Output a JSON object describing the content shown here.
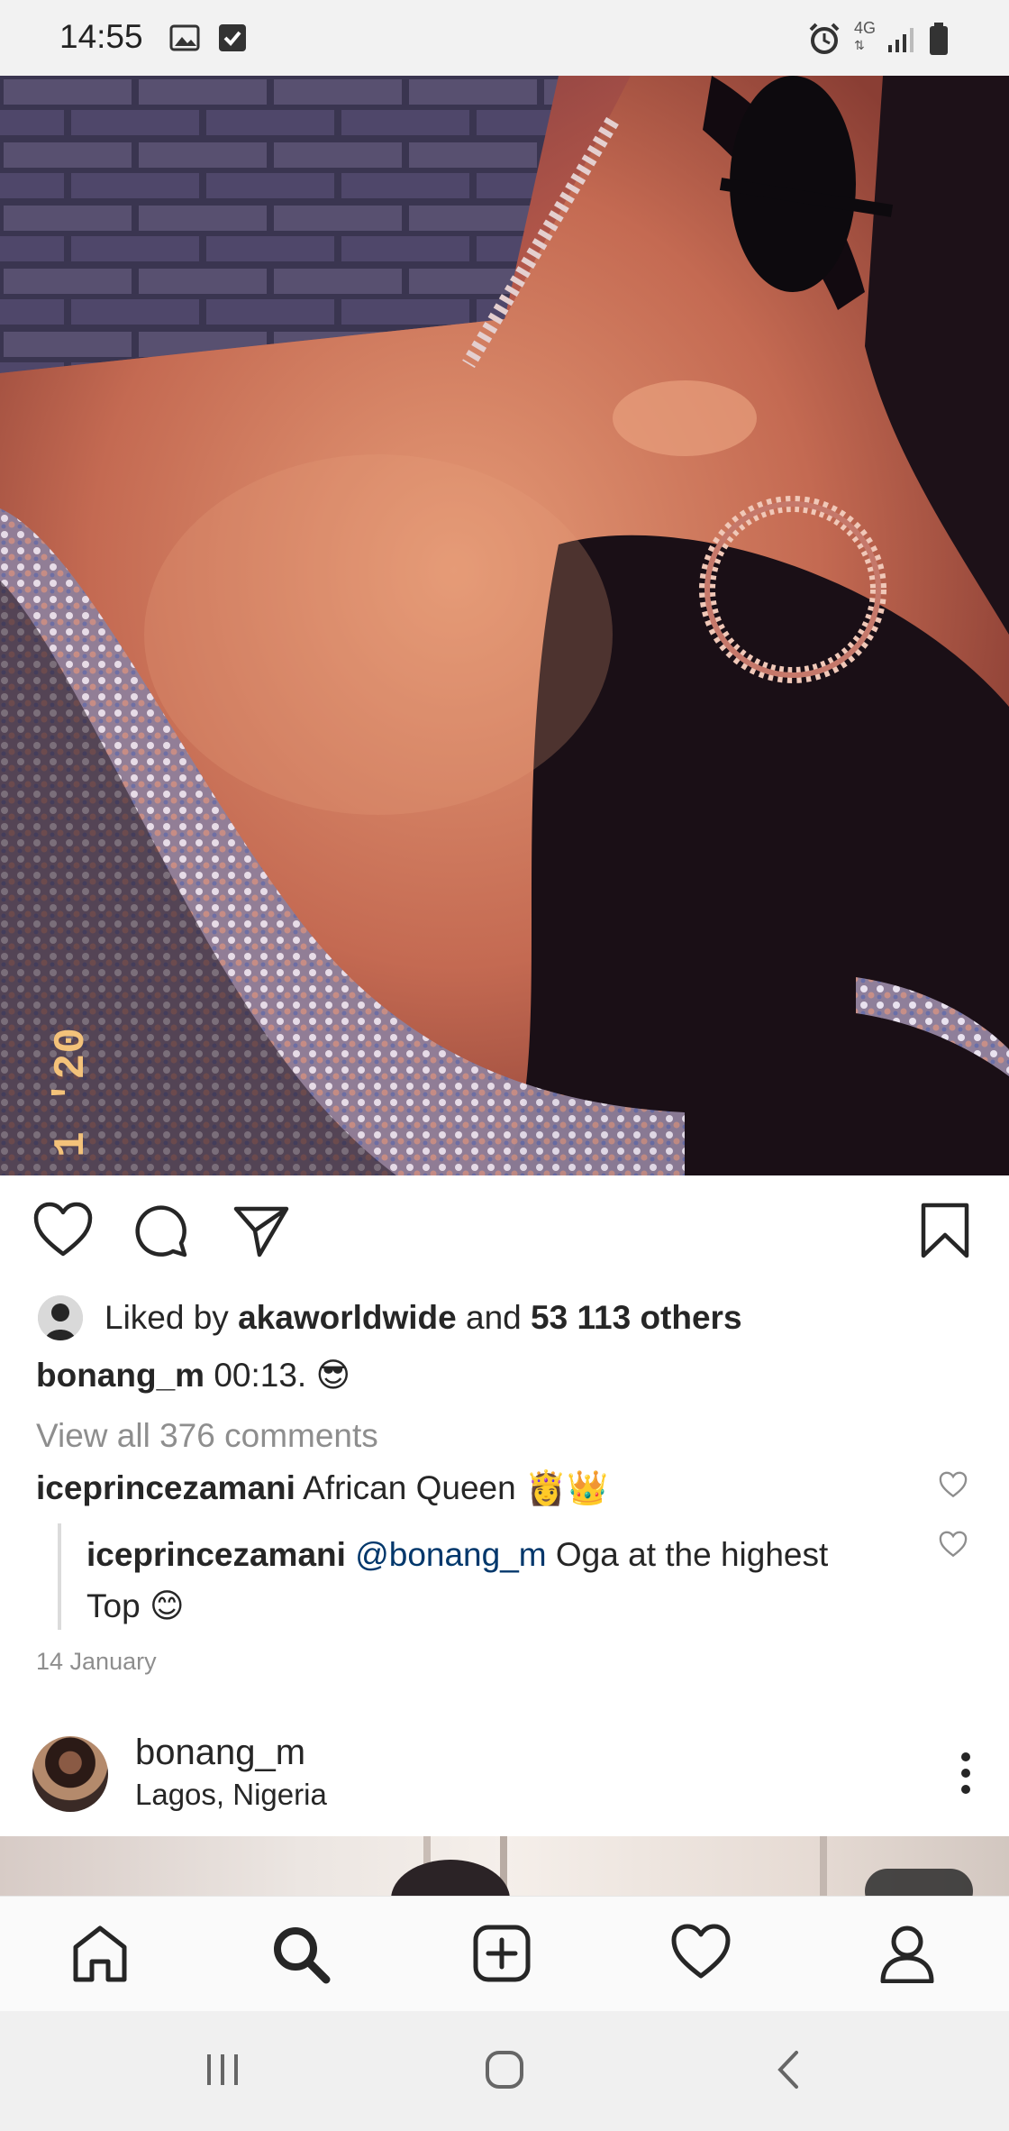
{
  "status_bar": {
    "time": "14:55",
    "network": "4G",
    "left_icons": [
      "gallery-icon",
      "check-box-icon"
    ],
    "right_icons": [
      "alarm-icon",
      "4g-data-icon",
      "signal-icon",
      "battery-icon"
    ]
  },
  "post": {
    "photo_stamp": "1 '20",
    "actions": [
      "heart-icon",
      "comment-icon",
      "share-icon",
      "bookmark-icon"
    ],
    "likes": {
      "prefix": "Liked by",
      "user": "akaworldwide",
      "joiner": "and",
      "others": "53 113 others"
    },
    "caption": {
      "username": "bonang_m",
      "text": "00:13.",
      "emoji": "😎"
    },
    "view_comments": "View all 376 comments",
    "comments": [
      {
        "username": "iceprincezamani",
        "text": "African Queen",
        "emojis": "👸👑"
      },
      {
        "username": "iceprincezamani",
        "mention": "@bonang_m",
        "text_line1": "Oga at the highest",
        "text_line2": "Top",
        "emoji": "😊"
      }
    ],
    "date": "14 January"
  },
  "next_post": {
    "username": "bonang_m",
    "location": "Lagos, Nigeria"
  },
  "tab_bar": [
    "home-icon",
    "search-icon",
    "new-post-icon",
    "activity-icon",
    "profile-icon"
  ],
  "android_nav": [
    "recent-apps-icon",
    "home-button-icon",
    "back-icon"
  ],
  "colors": {
    "text": "#262626",
    "secondary_text": "#8e8e8e",
    "mention": "#00376b",
    "status_bar_bg": "#f2f2f2",
    "tab_bar_bg": "#fafafa",
    "nav_bar_bg": "#f0f0f0"
  }
}
